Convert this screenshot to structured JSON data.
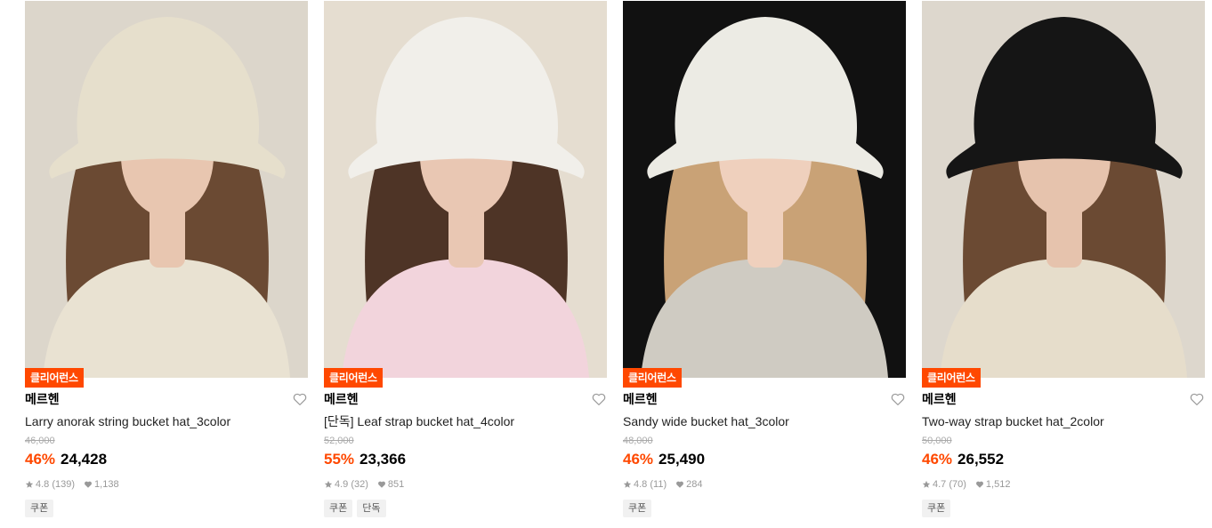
{
  "products": [
    {
      "badge": "클리어런스",
      "brand": "메르헨",
      "name": "Larry anorak string bucket hat_3color",
      "original_price": "46,000",
      "discount": "46%",
      "price": "24,428",
      "rating": "4.8",
      "reviews": "(139)",
      "likes": "1,138",
      "tags": [
        "쿠폰"
      ],
      "colors": {
        "bg": "#dcd6cb",
        "hat": "#e6dfcc",
        "hair": "#6b4a33",
        "top": "#e9e2d2",
        "skin": "#e8c6b0"
      }
    },
    {
      "badge": "클리어런스",
      "brand": "메르헨",
      "name": "[단독] Leaf strap bucket hat_4color",
      "original_price": "52,000",
      "discount": "55%",
      "price": "23,366",
      "rating": "4.9",
      "reviews": "(32)",
      "likes": "851",
      "tags": [
        "쿠폰",
        "단독"
      ],
      "colors": {
        "bg": "#e5ddd0",
        "hat": "#f1efea",
        "hair": "#4e3426",
        "top": "#f2d4dc",
        "skin": "#e9c7b3"
      }
    },
    {
      "badge": "클리어런스",
      "brand": "메르헨",
      "name": "Sandy wide bucket hat_3color",
      "original_price": "48,000",
      "discount": "46%",
      "price": "25,490",
      "rating": "4.8",
      "reviews": "(11)",
      "likes": "284",
      "tags": [
        "쿠폰"
      ],
      "colors": {
        "bg": "#111111",
        "hat": "#ecebe4",
        "hair": "#c9a276",
        "top": "#cfcbc2",
        "skin": "#efd0bd"
      }
    },
    {
      "badge": "클리어런스",
      "brand": "메르헨",
      "name": "Two-way strap bucket hat_2color",
      "original_price": "50,000",
      "discount": "46%",
      "price": "26,552",
      "rating": "4.7",
      "reviews": "(70)",
      "likes": "1,512",
      "tags": [
        "쿠폰"
      ],
      "colors": {
        "bg": "#ddd7cd",
        "hat": "#151515",
        "hair": "#6b4a33",
        "top": "#e6ddcb",
        "skin": "#e6c3ad"
      }
    }
  ],
  "icons": {
    "wishlist": "heart-outline-icon",
    "rating": "star-icon",
    "likes": "heart-filled-icon"
  },
  "accent_color": "#ff4800"
}
